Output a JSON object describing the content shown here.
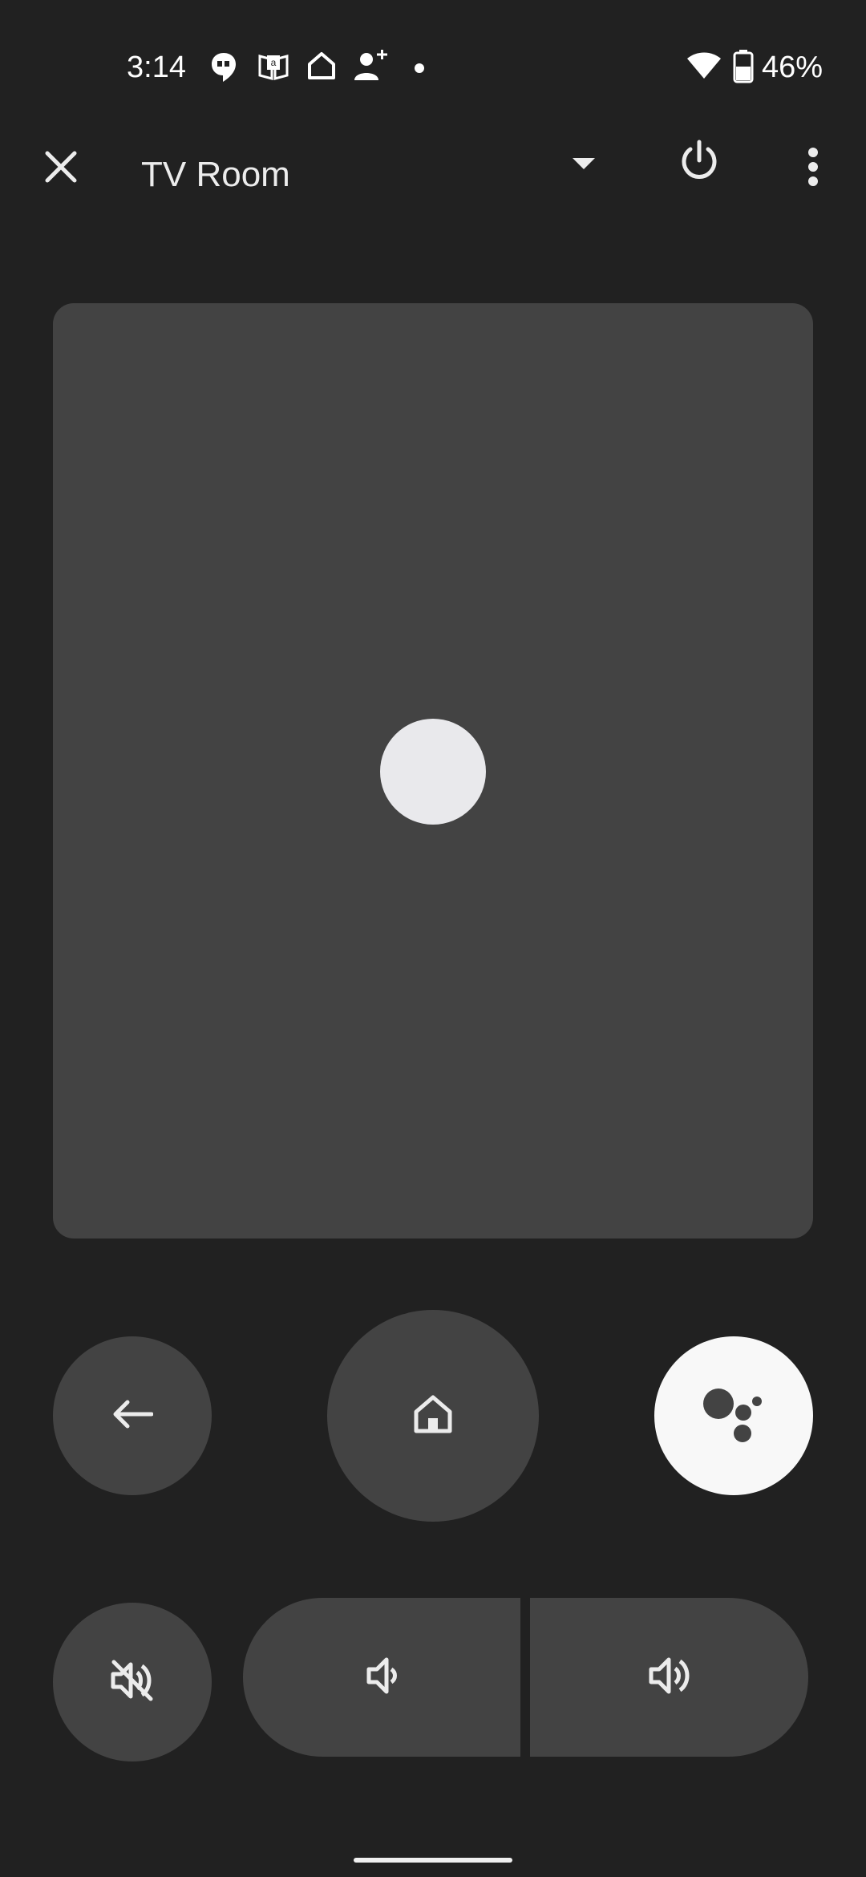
{
  "status_bar": {
    "time": "3:14",
    "battery": "46%",
    "icons": [
      "hangouts-icon",
      "amazon-kindle-icon",
      "home-icon",
      "add-person-icon",
      "dot-icon",
      "wifi-icon",
      "battery-icon"
    ]
  },
  "app_bar": {
    "title": "TV Room",
    "close_icon": "close-icon",
    "dropdown_icon": "dropdown-arrow-icon",
    "power_icon": "power-icon",
    "more_icon": "more-vert-icon"
  },
  "controls": {
    "back_icon": "back-arrow-icon",
    "home_icon": "home-icon",
    "assistant_icon": "google-assistant-icon",
    "mute_icon": "volume-off-icon",
    "volume_down_icon": "volume-down-icon",
    "volume_up_icon": "volume-up-icon"
  },
  "colors": {
    "background": "#212121",
    "surface": "#434343",
    "assistant_button": "#f8f8f8",
    "icon": "#ececec"
  }
}
